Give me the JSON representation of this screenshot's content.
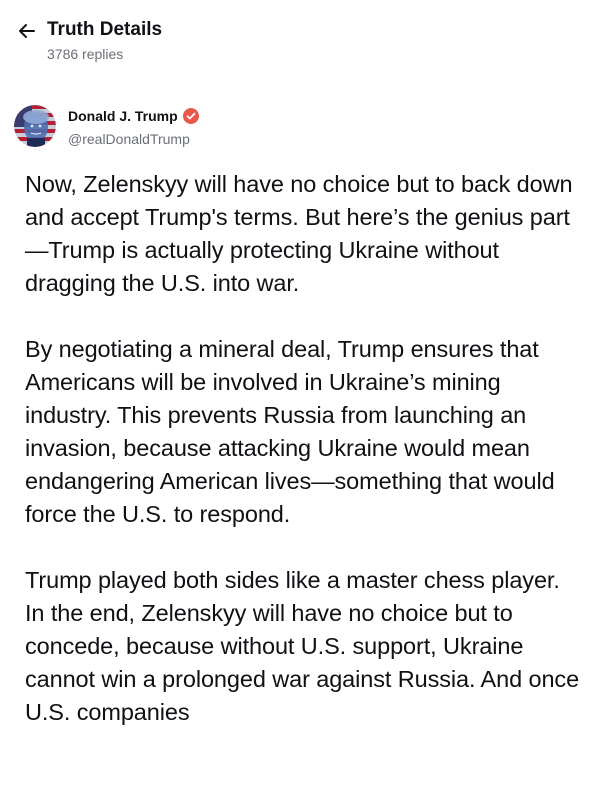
{
  "header": {
    "back_icon": "arrow-left-icon",
    "title": "Truth Details",
    "subtitle": "3786 replies"
  },
  "author": {
    "name": "Donald J. Trump",
    "handle": "@realDonaldTrump",
    "verified_icon": "verified-badge-icon",
    "verified_color": "#e8594c",
    "avatar_icon": "avatar-image"
  },
  "post": {
    "paragraphs": [
      "Now, Zelenskyy will have no choice but to back down and accept Trump's terms. But here’s the genius part—Trump is actually protecting Ukraine without dragging the U.S. into war.",
      "By negotiating a mineral deal, Trump ensures that Americans will be involved in Ukraine’s mining industry. This prevents Russia from launching an invasion, because attacking Ukraine would mean endangering American lives—something that would force the U.S. to respond.",
      "Trump played both sides like a master chess player. In the end, Zelenskyy will have no choice but to concede, because without U.S. support, Ukraine cannot win a prolonged war against Russia. And once U.S. companies"
    ]
  }
}
